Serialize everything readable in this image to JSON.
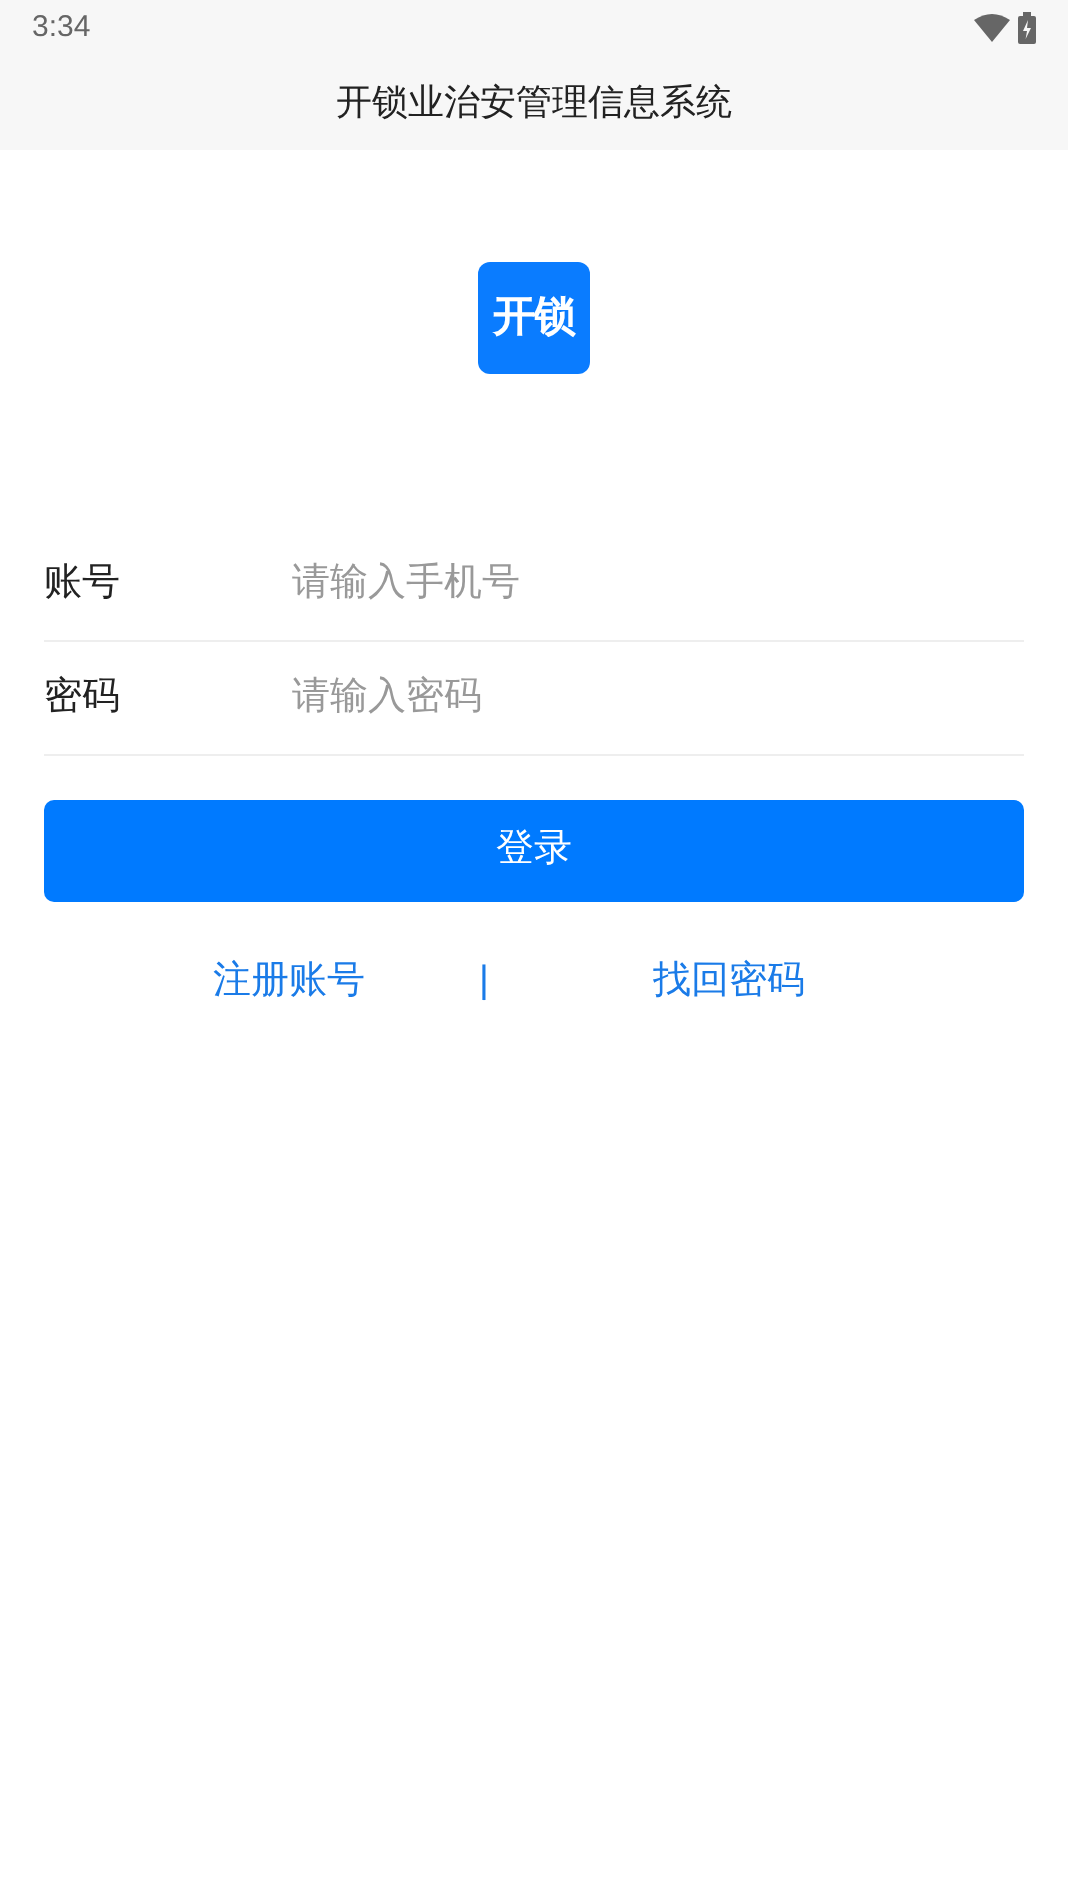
{
  "status_bar": {
    "time": "3:34"
  },
  "title_bar": {
    "title": "开锁业治安管理信息系统"
  },
  "logo": {
    "text": "开锁"
  },
  "fields": [
    {
      "label": "账号",
      "placeholder": "请输入手机号"
    },
    {
      "label": "密码",
      "placeholder": "请输入密码"
    }
  ],
  "login_button": "登录",
  "links": [
    {
      "label": "注册账号"
    },
    {
      "label": "找回密码"
    }
  ],
  "link_separator": "|"
}
